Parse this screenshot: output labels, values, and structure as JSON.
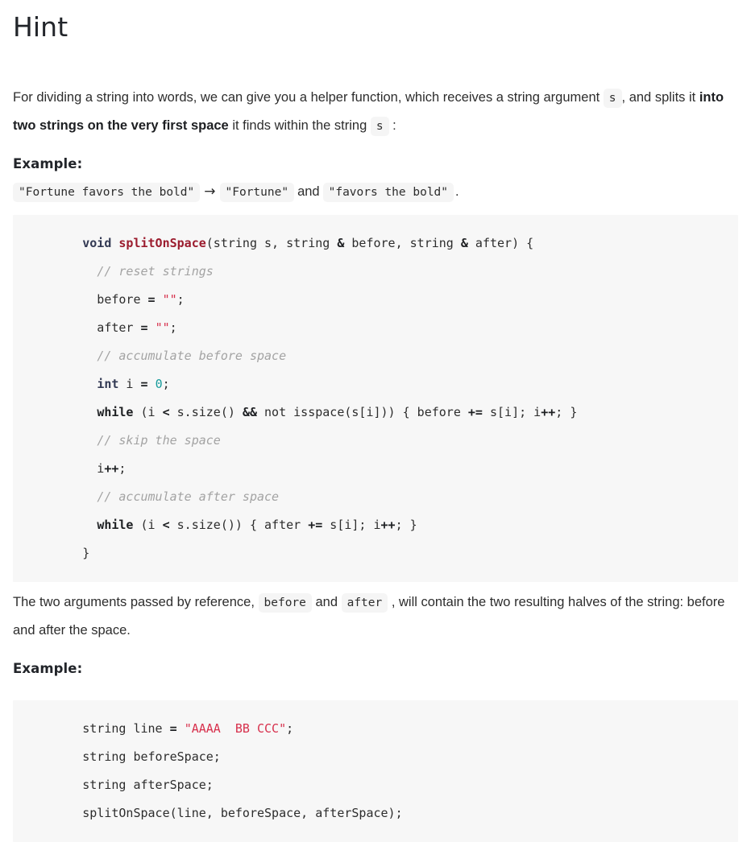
{
  "page": {
    "title": "Hint"
  },
  "intro": {
    "part1": "For dividing a string into words, we can give you a helper function, which receives a string argument ",
    "chip_s_1": "s",
    "part2": ", and splits it ",
    "emphasis": "into two strings on the very first space",
    "part3": " it finds within the string ",
    "chip_s_2": "s",
    "part4": " :"
  },
  "example_heading_1": "Example:",
  "example_line": {
    "input": "\"Fortune favors the bold\"",
    "arrow": "→",
    "output_before": "\"Fortune\"",
    "conjunction": "and",
    "output_after": "\"favors the bold\"",
    "period": "."
  },
  "code_block_1": {
    "lines": [
      [
        {
          "t": "        ",
          "c": "pl"
        },
        {
          "t": "void",
          "c": "kw"
        },
        {
          "t": " ",
          "c": "pl"
        },
        {
          "t": "splitOnSpace",
          "c": "fn"
        },
        {
          "t": "(string s, string ",
          "c": "pl"
        },
        {
          "t": "&",
          "c": "op"
        },
        {
          "t": " before, string ",
          "c": "pl"
        },
        {
          "t": "&",
          "c": "op"
        },
        {
          "t": " after) {",
          "c": "pl"
        }
      ],
      [
        {
          "t": "          ",
          "c": "pl"
        },
        {
          "t": "// reset strings",
          "c": "cmt"
        }
      ],
      [
        {
          "t": "          before ",
          "c": "pl"
        },
        {
          "t": "=",
          "c": "op"
        },
        {
          "t": " ",
          "c": "pl"
        },
        {
          "t": "\"\"",
          "c": "str"
        },
        {
          "t": ";",
          "c": "pl"
        }
      ],
      [
        {
          "t": "          after ",
          "c": "pl"
        },
        {
          "t": "=",
          "c": "op"
        },
        {
          "t": " ",
          "c": "pl"
        },
        {
          "t": "\"\"",
          "c": "str"
        },
        {
          "t": ";",
          "c": "pl"
        }
      ],
      [
        {
          "t": "          ",
          "c": "pl"
        },
        {
          "t": "// accumulate before space",
          "c": "cmt"
        }
      ],
      [
        {
          "t": "          ",
          "c": "pl"
        },
        {
          "t": "int",
          "c": "kw"
        },
        {
          "t": " i ",
          "c": "pl"
        },
        {
          "t": "=",
          "c": "op"
        },
        {
          "t": " ",
          "c": "pl"
        },
        {
          "t": "0",
          "c": "num"
        },
        {
          "t": ";",
          "c": "pl"
        }
      ],
      [
        {
          "t": "          ",
          "c": "pl"
        },
        {
          "t": "while",
          "c": "ctl"
        },
        {
          "t": " (i ",
          "c": "pl"
        },
        {
          "t": "<",
          "c": "op"
        },
        {
          "t": " s.size() ",
          "c": "pl"
        },
        {
          "t": "&&",
          "c": "op"
        },
        {
          "t": " not isspace(s[i])) { before ",
          "c": "pl"
        },
        {
          "t": "+=",
          "c": "op"
        },
        {
          "t": " s[i]; i",
          "c": "pl"
        },
        {
          "t": "++",
          "c": "op"
        },
        {
          "t": "; }",
          "c": "pl"
        }
      ],
      [
        {
          "t": "          ",
          "c": "pl"
        },
        {
          "t": "// skip the space",
          "c": "cmt"
        }
      ],
      [
        {
          "t": "          i",
          "c": "pl"
        },
        {
          "t": "++",
          "c": "op"
        },
        {
          "t": ";",
          "c": "pl"
        }
      ],
      [
        {
          "t": "          ",
          "c": "pl"
        },
        {
          "t": "// accumulate after space",
          "c": "cmt"
        }
      ],
      [
        {
          "t": "          ",
          "c": "pl"
        },
        {
          "t": "while",
          "c": "ctl"
        },
        {
          "t": " (i ",
          "c": "pl"
        },
        {
          "t": "<",
          "c": "op"
        },
        {
          "t": " s.size()) { after ",
          "c": "pl"
        },
        {
          "t": "+=",
          "c": "op"
        },
        {
          "t": " s[i]; i",
          "c": "pl"
        },
        {
          "t": "++",
          "c": "op"
        },
        {
          "t": "; }",
          "c": "pl"
        }
      ],
      [
        {
          "t": "        }",
          "c": "pl"
        }
      ]
    ]
  },
  "outro": {
    "part1": "The two arguments passed by reference, ",
    "chip_before": "before",
    "part2": " and ",
    "chip_after": "after",
    "part3": " , will contain the two resulting halves of the string: before and after the space."
  },
  "example_heading_2": "Example:",
  "code_block_2": {
    "lines": [
      [
        {
          "t": "        string line ",
          "c": "pl"
        },
        {
          "t": "=",
          "c": "op"
        },
        {
          "t": " ",
          "c": "pl"
        },
        {
          "t": "\"AAAA  BB CCC\"",
          "c": "str"
        },
        {
          "t": ";",
          "c": "pl"
        }
      ],
      [
        {
          "t": "        string beforeSpace;",
          "c": "pl"
        }
      ],
      [
        {
          "t": "        string afterSpace;",
          "c": "pl"
        }
      ],
      [
        {
          "t": "        splitOnSpace(line, beforeSpace, afterSpace);",
          "c": "pl"
        }
      ]
    ]
  },
  "colors": {
    "code_block_bg": "#f7f7f7",
    "chip_bg": "#f5f5f5",
    "keyword": "#333a54",
    "function": "#9b1c2e",
    "string": "#d7304c",
    "number": "#179b9b",
    "comment": "#a3a3a3",
    "text": "#2d2d2d"
  }
}
